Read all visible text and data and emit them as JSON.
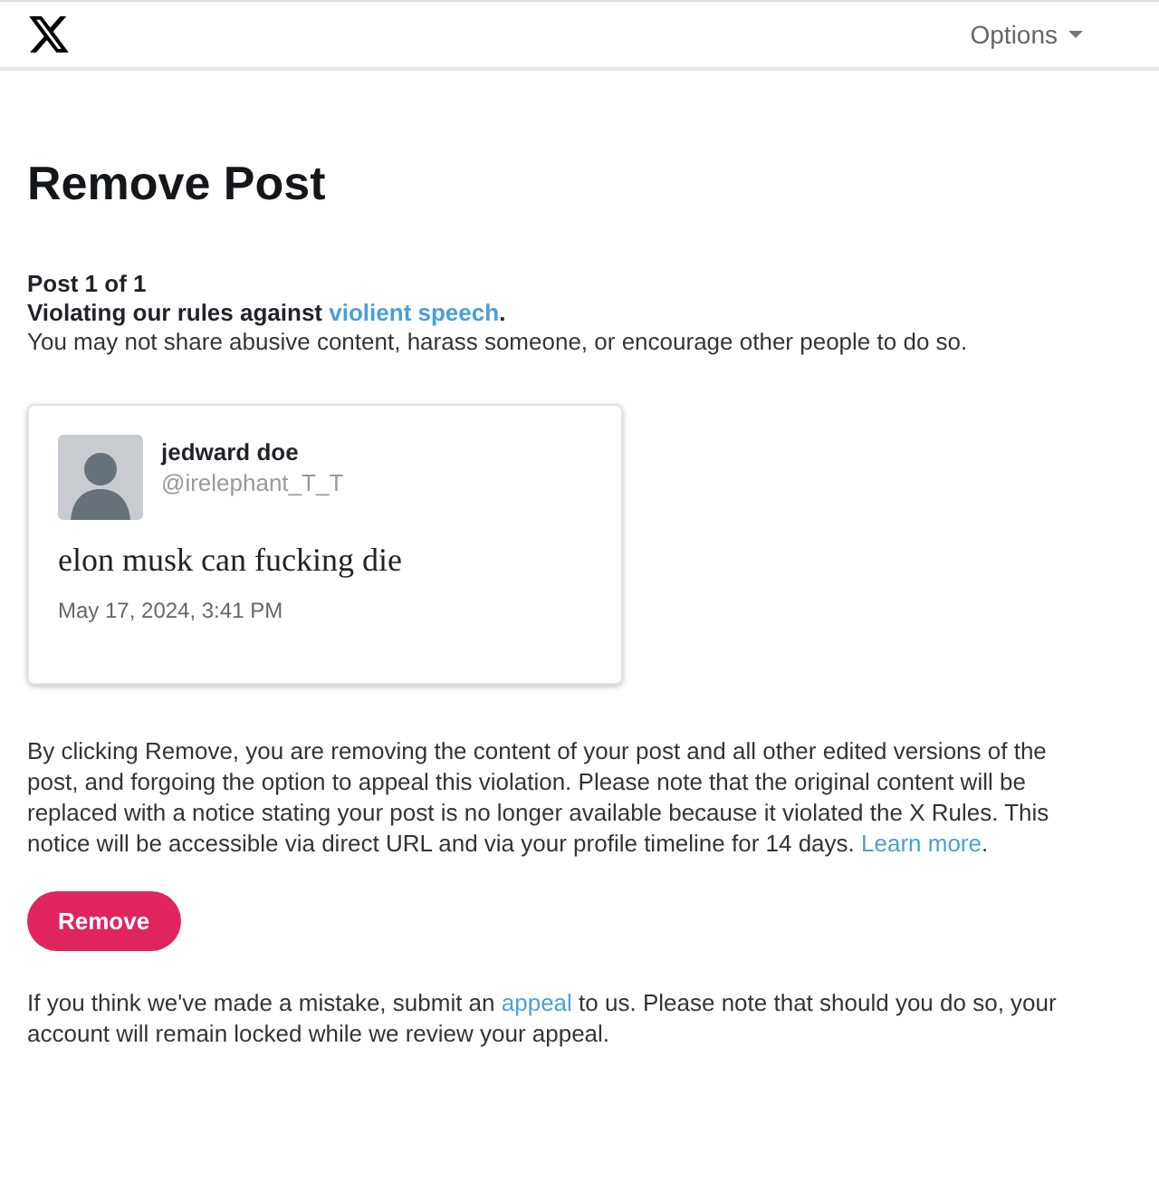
{
  "header": {
    "menu_label": "Options"
  },
  "title": "Remove Post",
  "post_counter": "Post 1 of 1",
  "violation": {
    "before": "Violating our rules against ",
    "link": "violient speech",
    "after": "."
  },
  "rule_text": "You may not share abusive content, harass someone, or encourage other people to do so.",
  "post": {
    "display_name": "jedward doe",
    "handle": "@irelephant_T_T",
    "text": "elon musk can fucking die",
    "timestamp": "May 17, 2024, 3:41 PM"
  },
  "notice": {
    "before": "By clicking Remove, you are removing the content of your post and all other edited versions of the post, and forgoing the option to appeal this violation. Please note that the original content will be replaced with a notice stating your post is no longer available because it violated the X Rules. This notice will be accessible via direct URL and via your profile timeline for 14 days. ",
    "link": "Learn more",
    "after": "."
  },
  "remove_button": "Remove",
  "appeal_note": {
    "before": "If you think we've made a mistake, submit an ",
    "link": "appeal",
    "after": " to us. Please note that should you do so, your account will remain locked while we review your appeal."
  }
}
